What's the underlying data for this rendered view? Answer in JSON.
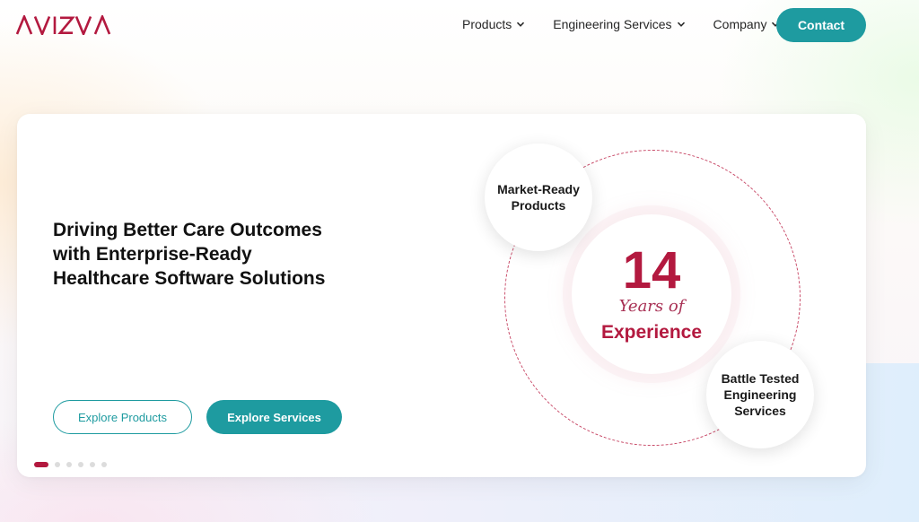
{
  "header": {
    "logo_text": "AVIZVA",
    "nav": [
      {
        "label": "Products"
      },
      {
        "label": "Engineering Services"
      },
      {
        "label": "Company"
      }
    ],
    "contact_label": "Contact"
  },
  "hero": {
    "headline_line1": "Driving Better Care Outcomes",
    "headline_with": "with ",
    "headline_bold1": "Enterprise-Ready",
    "headline_bold2": "Healthcare Software Solutions",
    "buttons": {
      "explore_products": "Explore Products",
      "explore_services": "Explore Services"
    },
    "carousel": {
      "total_slides": 6,
      "active_index": 0
    },
    "graphic": {
      "years_number": "14",
      "years_of": "Years of",
      "experience": "Experience",
      "bubble_top": [
        "Market-Ready",
        "Products"
      ],
      "bubble_bottom": [
        "Battle Tested",
        "Engineering",
        "Services"
      ]
    }
  },
  "colors": {
    "brand": "#b3193f",
    "accent": "#1e9ba0"
  },
  "icons": {
    "nav_chevron": "chevron-down-icon"
  }
}
